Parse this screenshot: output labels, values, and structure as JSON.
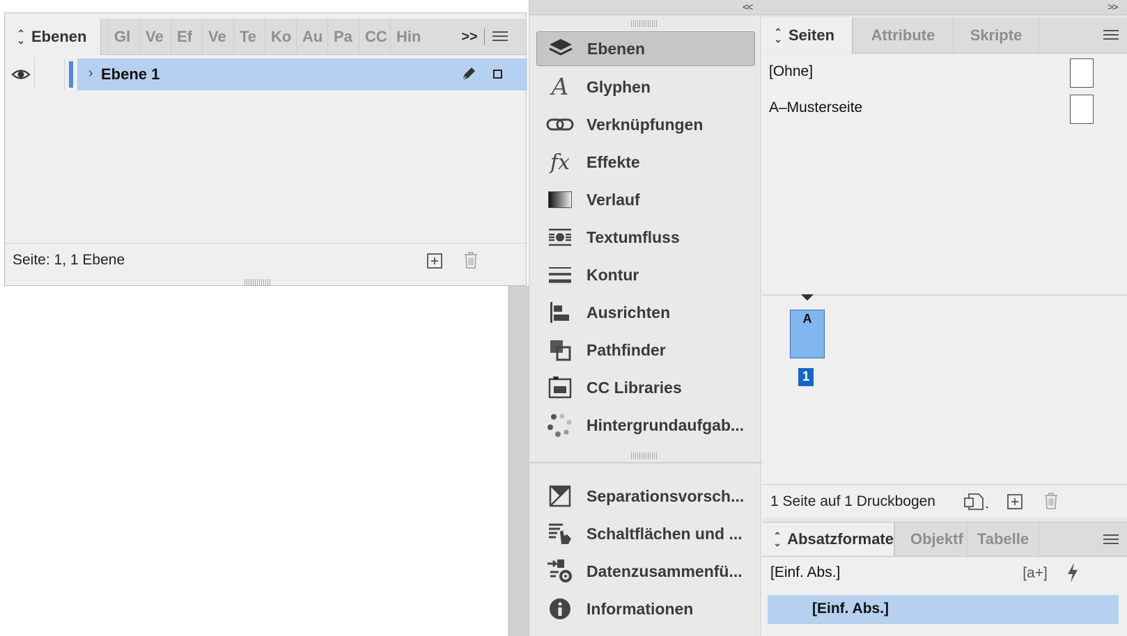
{
  "layers_panel": {
    "active_tab": "Ebenen",
    "collapsed_tabs": [
      "Gl",
      "Ve",
      "Ef",
      "Ve",
      "Te",
      "Ko",
      "Au",
      "Pa",
      "CC",
      "Hin"
    ],
    "overflow_label": ">>",
    "layers": [
      {
        "name": "Ebene 1",
        "color": "#4c8ae6",
        "visible": true,
        "selected": true
      }
    ],
    "footer_status": "Seite: 1, 1 Ebene"
  },
  "dock": {
    "collapse_label": "<<",
    "items": [
      {
        "label": "Ebenen",
        "icon": "layers-icon",
        "active": true
      },
      {
        "label": "Glyphen",
        "icon": "glyph-icon"
      },
      {
        "label": "Verknüpfungen",
        "icon": "link-icon"
      },
      {
        "label": "Effekte",
        "icon": "fx-icon"
      },
      {
        "label": "Verlauf",
        "icon": "gradient-icon"
      },
      {
        "label": "Textumfluss",
        "icon": "text-wrap-icon"
      },
      {
        "label": "Kontur",
        "icon": "stroke-icon"
      },
      {
        "label": "Ausrichten",
        "icon": "align-icon"
      },
      {
        "label": "Pathfinder",
        "icon": "pathfinder-icon"
      },
      {
        "label": "CC Libraries",
        "icon": "cc-libraries-icon"
      },
      {
        "label": "Hintergrundaufgab...",
        "icon": "background-tasks-icon"
      },
      {
        "label": "Separationsvorsch...",
        "icon": "separations-icon"
      },
      {
        "label": "Schaltflächen und ...",
        "icon": "buttons-forms-icon"
      },
      {
        "label": "Datenzusammenfü...",
        "icon": "data-merge-icon"
      },
      {
        "label": "Informationen",
        "icon": "info-icon"
      }
    ]
  },
  "pages_panel": {
    "collapse_label": ">>",
    "tabs": [
      "Seiten",
      "Attribute",
      "Skripte"
    ],
    "masters": [
      "[Ohne]",
      "A–Musterseite"
    ],
    "page_master_letter": "A",
    "page_number": "1",
    "footer_status": "1 Seite auf 1 Druckbogen"
  },
  "paragraph_panel": {
    "tabs": [
      "Absatzformate",
      "Objektf",
      "Tabelle"
    ],
    "current_style": "[Einf. Abs.]",
    "new_style_label": "[a+]",
    "styles": [
      "[Einf. Abs.]"
    ]
  },
  "colors": {
    "selection": "#b6d1f0",
    "layer_color": "#4c8ae6",
    "page_thumb": "#82b6ee",
    "page_number_bg": "#1565c8"
  }
}
